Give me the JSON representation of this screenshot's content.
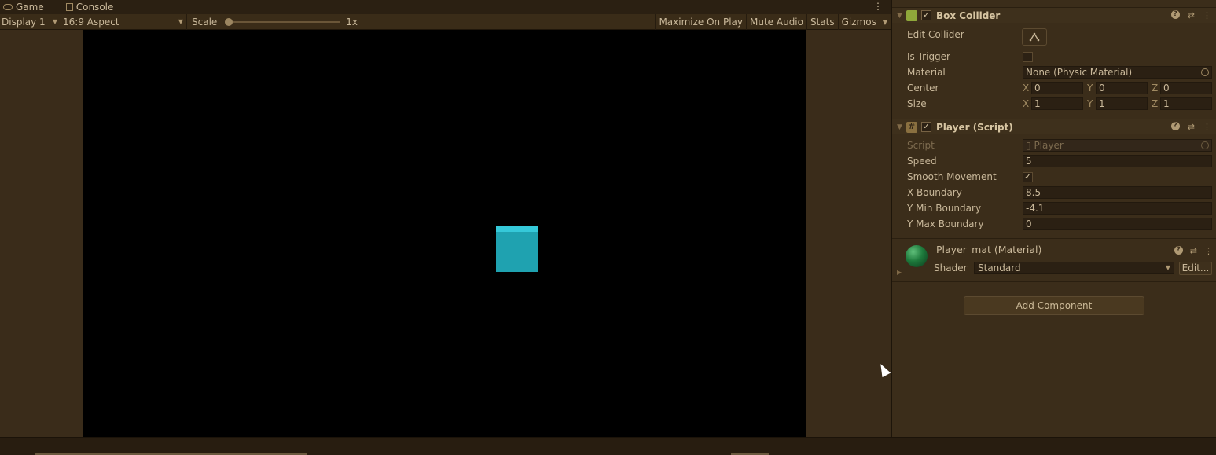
{
  "tabs": [
    {
      "label": "Game"
    },
    {
      "label": "Console"
    }
  ],
  "tab_menu_glyph": "⋮",
  "game_toolbar": {
    "display": "Display 1",
    "aspect": "16:9 Aspect",
    "scale_label": "Scale",
    "scale_value": "1x",
    "scale_slider_fraction": 0,
    "maximize_on_play": "Maximize On Play",
    "mute_audio": "Mute Audio",
    "stats": "Stats",
    "gizmos": "Gizmos"
  },
  "colors": {
    "accent_cyan": "#1fa2b0",
    "panel_bg": "#3b2d1a",
    "field_bg": "#2b2013"
  },
  "box_collider": {
    "title": "Box Collider",
    "enabled": true,
    "edit_collider_label": "Edit Collider",
    "is_trigger_label": "Is Trigger",
    "is_trigger": false,
    "material_label": "Material",
    "material_value": "None (Physic Material)",
    "center_label": "Center",
    "center": {
      "x": "0",
      "y": "0",
      "z": "0"
    },
    "size_label": "Size",
    "size": {
      "x": "1",
      "y": "1",
      "z": "1"
    }
  },
  "player_script": {
    "title": "Player (Script)",
    "enabled": true,
    "script_label": "Script",
    "script_value": "Player",
    "speed_label": "Speed",
    "speed": "5",
    "smooth_movement_label": "Smooth Movement",
    "smooth_movement": true,
    "x_boundary_label": "X Boundary",
    "x_boundary": "8.5",
    "y_min_boundary_label": "Y Min Boundary",
    "y_min_boundary": "-4.1",
    "y_max_boundary_label": "Y Max Boundary",
    "y_max_boundary": "0"
  },
  "material": {
    "title": "Player_mat (Material)",
    "shader_label": "Shader",
    "shader_value": "Standard",
    "edit_label": "Edit..."
  },
  "axis_labels": {
    "x": "X",
    "y": "Y",
    "z": "Z"
  },
  "check_glyph": "✓",
  "add_component_label": "Add Component",
  "icons": [
    "game-icon",
    "console-icon",
    "box-collider-icon",
    "script-icon",
    "help-icon",
    "preset-icon",
    "kebab-menu-icon",
    "object-picker-icon",
    "edit-collider-icon",
    "material-sphere-icon",
    "cursor-icon"
  ]
}
